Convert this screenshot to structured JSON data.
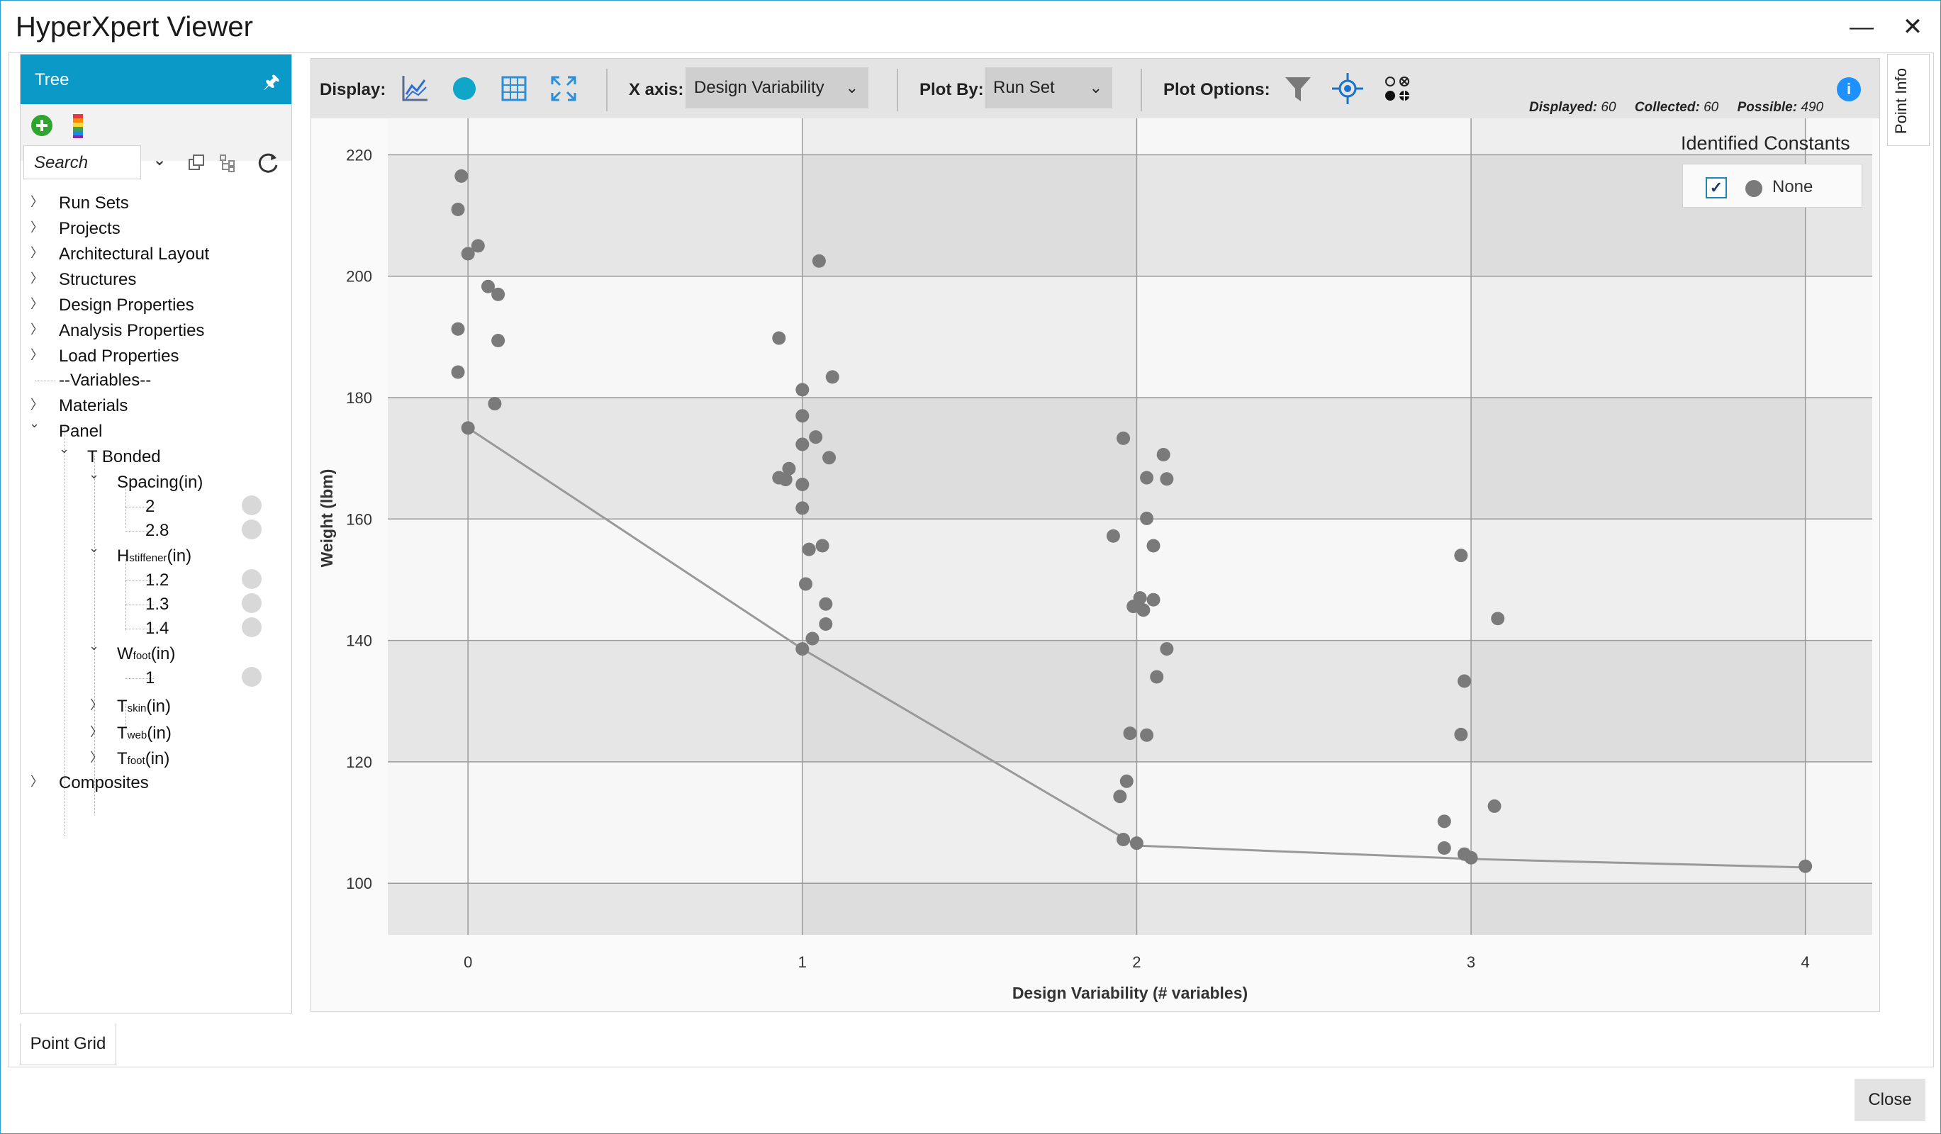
{
  "window": {
    "title": "HyperXpert Viewer",
    "minimize_label": "—",
    "close_label": "✕"
  },
  "tree": {
    "header": "Tree",
    "search_placeholder": "Search",
    "items": [
      {
        "label": "Run Sets"
      },
      {
        "label": "Projects"
      },
      {
        "label": "Architectural Layout"
      },
      {
        "label": "Structures"
      },
      {
        "label": "Design Properties"
      },
      {
        "label": "Analysis Properties"
      },
      {
        "label": "Load Properties"
      },
      {
        "label": "--Variables--"
      },
      {
        "label": "Materials"
      },
      {
        "label": "Panel"
      },
      {
        "label": "T Bonded"
      },
      {
        "label": "Spacing(in)"
      },
      {
        "label": "2"
      },
      {
        "label": "2.8"
      },
      {
        "label_main": "H",
        "label_sub": "stiffener",
        "label_unit": "(in)"
      },
      {
        "label": "1.2"
      },
      {
        "label": "1.3"
      },
      {
        "label": "1.4"
      },
      {
        "label_main": "W",
        "label_sub": "foot",
        "label_unit": "(in)"
      },
      {
        "label": "1"
      },
      {
        "label_main": "T",
        "label_sub": "skin",
        "label_unit": "(in)"
      },
      {
        "label_main": "T",
        "label_sub": "web",
        "label_unit": "(in)"
      },
      {
        "label_main": "T",
        "label_sub": "foot",
        "label_unit": "(in)"
      },
      {
        "label": "Composites"
      }
    ]
  },
  "toolbar": {
    "display_label": "Display:",
    "xaxis_label": "X axis:",
    "xaxis_value": "Design Variability",
    "plotby_label": "Plot By:",
    "plotby_value": "Run Set",
    "plotoptions_label": "Plot Options:",
    "displayed_label": "Displayed:",
    "displayed_value": "60",
    "collected_label": "Collected:",
    "collected_value": "60",
    "possible_label": "Possible:",
    "possible_value": "490",
    "icons": [
      "line-chart-icon",
      "dot-icon",
      "grid-icon",
      "expand-icon",
      "filter-icon",
      "target-icon",
      "symbols-icon",
      "info-icon"
    ]
  },
  "legend": {
    "title": "Identified Constants",
    "item": "None",
    "checked": true
  },
  "side_tab": "Point Info",
  "bottom_tab": "Point Grid",
  "close_button": "Close",
  "colors": {
    "accent": "#0b9ac8",
    "point": "#7a7a7a",
    "line": "#999999",
    "info": "#1e90ff"
  },
  "chart_data": {
    "type": "scatter",
    "xlabel": "Design Variability (# variables)",
    "ylabel": "Weight (lbm)",
    "xlim": [
      -0.24,
      4.2
    ],
    "ylim": [
      91.5,
      226
    ],
    "xticks": [
      0,
      1,
      2,
      3,
      4
    ],
    "yticks": [
      100,
      120,
      140,
      160,
      180,
      200,
      220
    ],
    "grid": true,
    "points": [
      [
        -0.02,
        216.5
      ],
      [
        -0.03,
        211
      ],
      [
        0.0,
        203.7
      ],
      [
        0.03,
        205
      ],
      [
        0.06,
        198.3
      ],
      [
        0.09,
        197
      ],
      [
        -0.03,
        191.3
      ],
      [
        0.09,
        189.4
      ],
      [
        -0.03,
        184.2
      ],
      [
        0.08,
        179
      ],
      [
        0.0,
        175
      ],
      [
        1.05,
        202.5
      ],
      [
        0.93,
        189.8
      ],
      [
        1.09,
        183.4
      ],
      [
        1.0,
        181.3
      ],
      [
        1.0,
        177
      ],
      [
        1.04,
        173.5
      ],
      [
        1.0,
        172.3
      ],
      [
        1.08,
        170.1
      ],
      [
        0.96,
        168.3
      ],
      [
        0.93,
        166.8
      ],
      [
        0.95,
        166.5
      ],
      [
        1.0,
        165.7
      ],
      [
        1.0,
        161.8
      ],
      [
        1.02,
        155
      ],
      [
        1.06,
        155.6
      ],
      [
        1.01,
        149.3
      ],
      [
        1.07,
        146
      ],
      [
        1.07,
        142.7
      ],
      [
        1.03,
        140.3
      ],
      [
        1.0,
        138.6
      ],
      [
        1.96,
        173.3
      ],
      [
        2.03,
        166.8
      ],
      [
        2.08,
        170.6
      ],
      [
        2.09,
        166.6
      ],
      [
        2.03,
        160.1
      ],
      [
        1.93,
        157.2
      ],
      [
        2.05,
        155.6
      ],
      [
        2.01,
        147
      ],
      [
        2.05,
        146.7
      ],
      [
        1.99,
        145.6
      ],
      [
        2.02,
        145
      ],
      [
        2.09,
        138.6
      ],
      [
        2.06,
        134
      ],
      [
        1.98,
        124.7
      ],
      [
        2.03,
        124.4
      ],
      [
        1.97,
        116.8
      ],
      [
        1.95,
        114.3
      ],
      [
        1.96,
        107.2
      ],
      [
        2.0,
        106.6
      ],
      [
        2.97,
        154
      ],
      [
        3.08,
        143.6
      ],
      [
        2.98,
        133.3
      ],
      [
        2.97,
        124.5
      ],
      [
        3.07,
        112.7
      ],
      [
        2.92,
        110.2
      ],
      [
        2.92,
        105.8
      ],
      [
        2.98,
        104.8
      ],
      [
        3.0,
        104.2
      ],
      [
        4.0,
        102.8
      ]
    ],
    "frontier": [
      [
        0,
        175
      ],
      [
        1,
        138.6
      ],
      [
        2,
        106.2
      ],
      [
        3,
        104
      ],
      [
        4,
        102.6
      ]
    ]
  }
}
